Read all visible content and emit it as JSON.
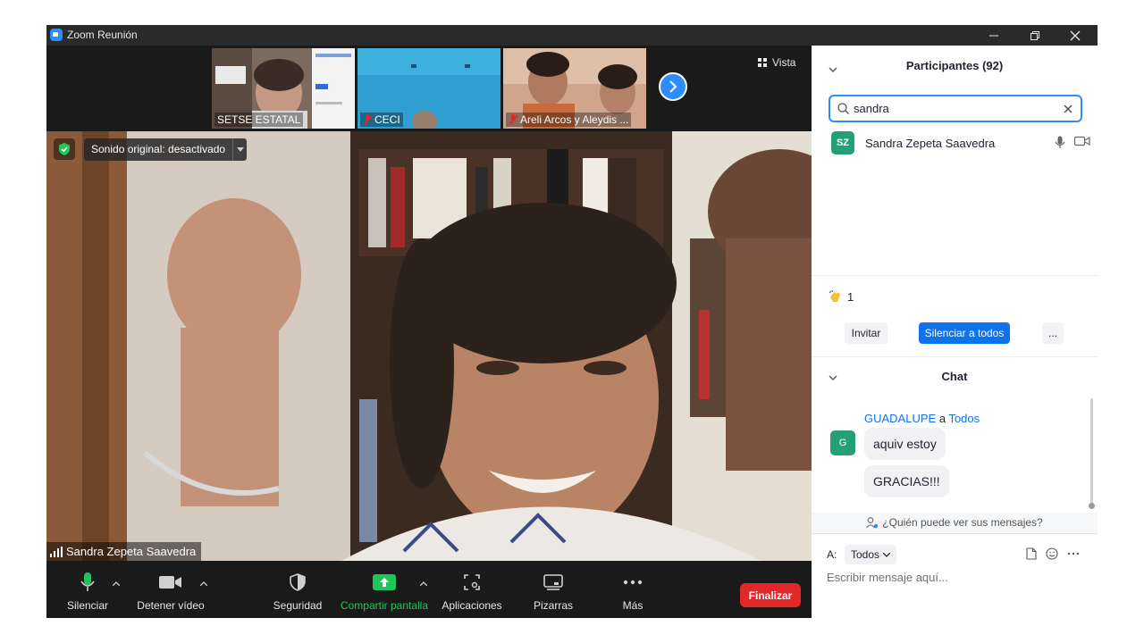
{
  "window": {
    "title": "Zoom Reunión"
  },
  "thumbnails": [
    {
      "name": "SETSE ESTATAL",
      "muted": false
    },
    {
      "name": "CECI",
      "muted": true
    },
    {
      "name": "Areli Arcos y Aleydis ...",
      "muted": true
    }
  ],
  "view_button": {
    "label": "Vista",
    "icon": "grid-icon"
  },
  "main_video": {
    "sound_label": "Sonido original: desactivado",
    "speaker_name": "Sandra Zepeta Saavedra"
  },
  "toolbar": {
    "mute_label": "Silenciar",
    "video_label": "Detener vídeo",
    "security_label": "Seguridad",
    "share_label": "Compartir pantalla",
    "apps_label": "Aplicaciones",
    "whiteboards_label": "Pizarras",
    "more_label": "Más",
    "end_label": "Finalizar"
  },
  "participants": {
    "title": "Participantes (92)",
    "search_value": "sandra",
    "results": [
      {
        "initials": "SZ",
        "name": "Sandra Zepeta Saavedra"
      }
    ],
    "reaction_count": "1",
    "invite_label": "Invitar",
    "mute_all_label": "Silenciar a todos",
    "more_label": "..."
  },
  "chat": {
    "title": "Chat",
    "message": {
      "sender": "GUADALUPE",
      "connector": "a",
      "recipient": "Todos",
      "avatar": "G",
      "lines": [
        "aquiv estoy",
        "GRACIAS!!!"
      ]
    },
    "who_sees": "¿Quién puede ver sus mensajes?",
    "to_label": "A:",
    "to_value": "Todos",
    "input_placeholder": "Escribir mensaje aquí..."
  },
  "colors": {
    "accent": "#2d8cff",
    "primary_button": "#0e72ed",
    "end_button": "#e02828",
    "avatar_green": "#23a074",
    "share_green": "#21c45a"
  }
}
